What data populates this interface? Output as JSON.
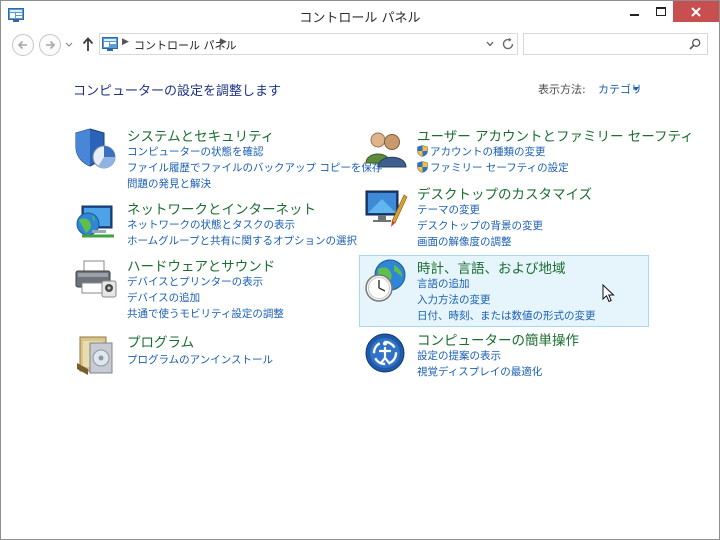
{
  "window": {
    "title": "コントロール パネル"
  },
  "address": {
    "path": "コントロール パネル",
    "search_placeholder": ""
  },
  "header": {
    "heading": "コンピューターの設定を調整します",
    "view_by_label": "表示方法:",
    "view_by_value": "カテゴリ"
  },
  "categories": {
    "system": {
      "title": "システムとセキュリティ",
      "links": [
        "コンピューターの状態を確認",
        "ファイル履歴でファイルのバックアップ コピーを保存",
        "問題の発見と解決"
      ]
    },
    "network": {
      "title": "ネットワークとインターネット",
      "links": [
        "ネットワークの状態とタスクの表示",
        "ホームグループと共有に関するオプションの選択"
      ]
    },
    "hardware": {
      "title": "ハードウェアとサウンド",
      "links": [
        "デバイスとプリンターの表示",
        "デバイスの追加",
        "共通で使うモビリティ設定の調整"
      ]
    },
    "programs": {
      "title": "プログラム",
      "links": [
        "プログラムのアンインストール"
      ]
    },
    "users": {
      "title": "ユーザー アカウントとファミリー セーフティ",
      "links": [
        "アカウントの種類の変更",
        "ファミリー セーフティの設定"
      ]
    },
    "appearance": {
      "title": "デスクトップのカスタマイズ",
      "links": [
        "テーマの変更",
        "デスクトップの背景の変更",
        "画面の解像度の調整"
      ]
    },
    "clock": {
      "title": "時計、言語、および地域",
      "links": [
        "言語の追加",
        "入力方法の変更",
        "日付、時刻、または数値の形式の変更"
      ]
    },
    "ease": {
      "title": "コンピューターの簡単操作",
      "links": [
        "設定の提案の表示",
        "視覚ディスプレイの最適化"
      ]
    }
  }
}
